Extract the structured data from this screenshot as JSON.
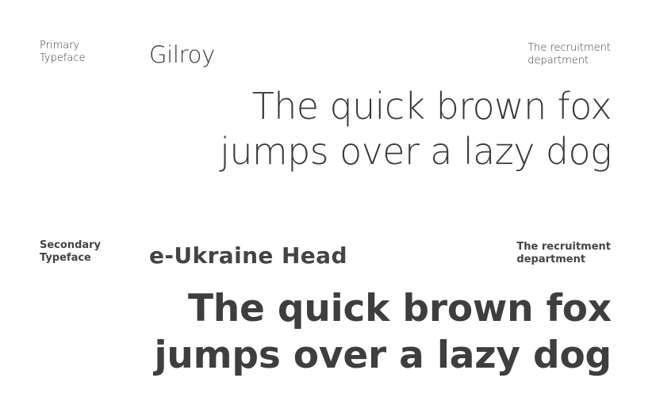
{
  "primary": {
    "label": "Primary\nTypeface",
    "name": "Gilroy",
    "department": "The recruitment\ndepartment",
    "sample": "The quick brown fox\njumps over a lazy dog"
  },
  "secondary": {
    "label": "Secondary\nTypeface",
    "name": "e-Ukraine Head",
    "department": "The recruitment\ndepartment",
    "sample": "The quick brown fox\njumps over a lazy dog"
  },
  "colors": {
    "text": "#3a3a3a",
    "background": "#ffffff"
  }
}
